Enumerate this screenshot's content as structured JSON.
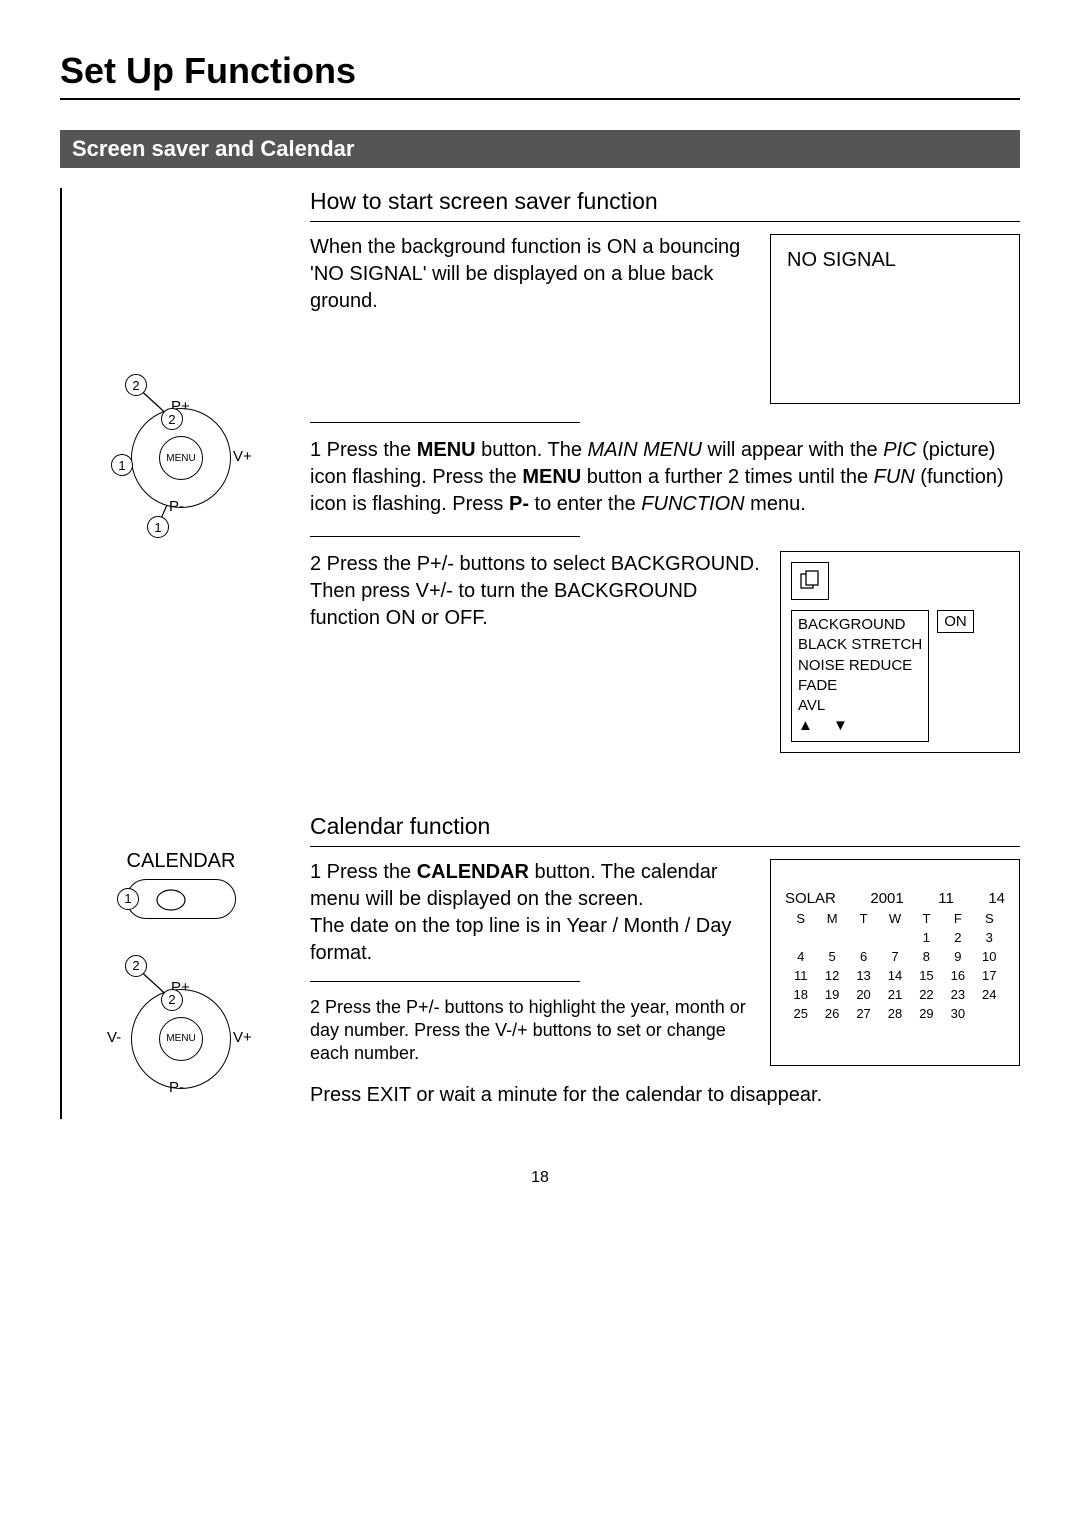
{
  "page_title": "Set Up Functions",
  "section_title": "Screen saver and Calendar",
  "screensaver": {
    "heading": "How to start screen saver function",
    "intro": "When the background function is ON a bouncing 'NO SIGNAL' will be displayed on a blue back ground.",
    "no_signal": "NO SIGNAL",
    "step1_pre": "1 Press the ",
    "step1_menu": "MENU",
    "step1_mid1": " button. The ",
    "step1_mainmenu": "MAIN MENU",
    "step1_mid2": " will appear with the ",
    "step1_pic": "PIC",
    "step1_mid3": " (picture) icon flashing. Press the ",
    "step1_menu2": "MENU",
    "step1_mid4": " button a further 2 times until the ",
    "step1_fun": "FUN",
    "step1_mid5": " (function) icon is flashing. Press ",
    "step1_pminus": "P-",
    "step1_mid6": " to enter the ",
    "step1_function": "FUNCTION",
    "step1_end": " menu.",
    "step2": "2 Press the P+/- buttons to select BACKGROUND. Then press V+/- to turn the BACKGROUND function ON or OFF.",
    "menu": {
      "items": [
        "BACKGROUND",
        "BLACK STRETCH",
        "NOISE REDUCE",
        "FADE",
        "AVL"
      ],
      "value": "ON",
      "arrows": "▲  ▼"
    }
  },
  "remote": {
    "menu_label": "MENU",
    "p_plus": "P+",
    "p_minus": "P-",
    "v_plus": "V+",
    "v_minus": "V-",
    "callout_1": "1",
    "callout_2": "2"
  },
  "calendar": {
    "heading": "Calendar function",
    "label": "CALENDAR",
    "step1_pre": "1 Press the ",
    "step1_btn": "CALENDAR",
    "step1_post": " button. The calendar menu will be displayed on the screen.",
    "step1_line2": "The date on the top line is in Year / Month / Day format.",
    "step2": "2 Press the P+/- buttons to highlight the year, month or day number. Press the V-/+ buttons to set or change each number.",
    "exit": "Press EXIT or wait a minute for the calendar to disappear.",
    "box": {
      "solar": "SOLAR",
      "year": "2001",
      "month": "11",
      "day": "14",
      "dow": [
        "S",
        "M",
        "T",
        "W",
        "T",
        "F",
        "S"
      ],
      "cells": [
        "",
        "",
        "",
        "",
        "1",
        "2",
        "3",
        "4",
        "5",
        "6",
        "7",
        "8",
        "9",
        "10",
        "11",
        "12",
        "13",
        "14",
        "15",
        "16",
        "17",
        "18",
        "19",
        "20",
        "21",
        "22",
        "23",
        "24",
        "25",
        "26",
        "27",
        "28",
        "29",
        "30",
        "",
        ""
      ]
    }
  },
  "page_number": "18"
}
